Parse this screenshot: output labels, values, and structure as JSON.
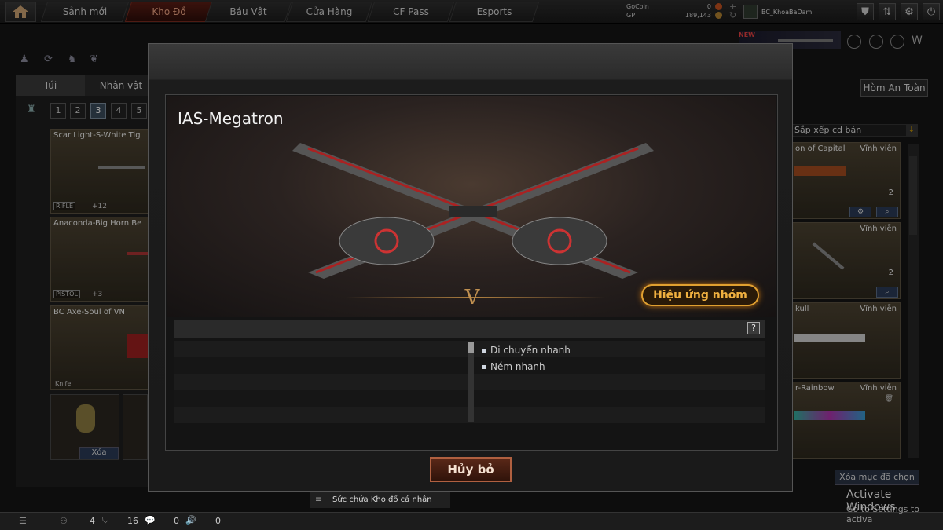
{
  "nav": {
    "home_icon": "home-icon",
    "tabs": [
      {
        "label": "Sảnh mới"
      },
      {
        "label": "Kho Đồ"
      },
      {
        "label": "Báu Vật"
      },
      {
        "label": "Cửa Hàng"
      },
      {
        "label": "CF Pass"
      },
      {
        "label": "Esports"
      }
    ]
  },
  "currency": {
    "gocoin_label": "GoCoin",
    "gocoin_value": "0",
    "gp_label": "GP",
    "gp_value": "189,143"
  },
  "user": {
    "name": "BC_KhoaBaDam"
  },
  "promo_badge": "NEW",
  "left_panel": {
    "tabs": [
      "Túi",
      "Nhân vật"
    ],
    "pages": [
      "1",
      "2",
      "3",
      "4",
      "5"
    ],
    "active_page": "3",
    "items": [
      {
        "name": "Scar Light-S-White Tig",
        "type": "RIFLE",
        "count": "+12"
      },
      {
        "name": "Anaconda-Big Horn Be",
        "type": "PISTOL",
        "count": "+3"
      },
      {
        "name": "BC Axe-Soul of VN",
        "type": "Knife",
        "count": ""
      }
    ],
    "grenade_delete": "Xóa"
  },
  "right_panel": {
    "safe_button": "Hòm An Toàn",
    "sort_label": "Sắp xếp cd bản",
    "items": [
      {
        "name": "on of Capital",
        "perm": "Vĩnh viễn",
        "count": "2"
      },
      {
        "name": "",
        "perm": "Vĩnh viễn",
        "count": "2"
      },
      {
        "name": "kull",
        "perm": "Vĩnh viễn",
        "count": ""
      },
      {
        "name": "r-Rainbow",
        "perm": "Vĩnh viễn",
        "count": ""
      }
    ],
    "delete_selected": "Xóa mục đã chọn"
  },
  "modal": {
    "title": "IAS-Megatron",
    "group_effect_button": "Hiệu ứng nhóm",
    "help": "?",
    "effects": [
      "Di chuyển nhanh",
      "Ném nhanh"
    ],
    "cancel_button": "Hủy bỏ"
  },
  "bottom": {
    "storage_label": "Sức chứa Kho đồ cá nhân",
    "stat1": "4",
    "stat2": "16",
    "stat3": "0",
    "stat4": "0"
  },
  "watermark": {
    "title": "Activate Windows",
    "subtitle": "Go to Settings to activa"
  },
  "colors": {
    "accent_red": "#5a1d14",
    "gold": "#e0a030"
  }
}
